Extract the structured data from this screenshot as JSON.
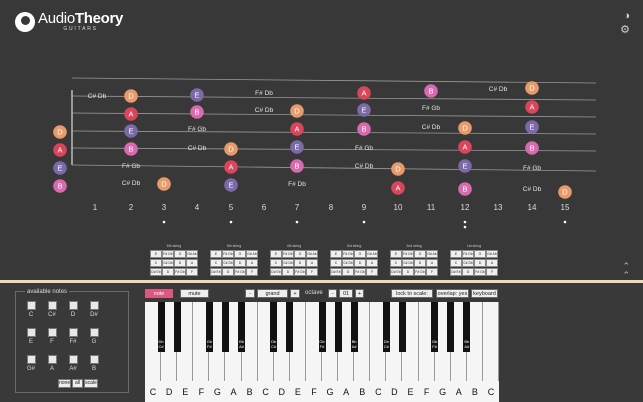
{
  "app": {
    "logo_main_a": "Audio",
    "logo_main_b": "Theory",
    "logo_sub": "GUITARS"
  },
  "toolbar": {
    "help_icon": "help-circle-icon",
    "settings_icon": "gear-icon"
  },
  "fret_numbers": [
    "1",
    "2",
    "3",
    "4",
    "5",
    "6",
    "7",
    "8",
    "9",
    "10",
    "11",
    "12",
    "13",
    "14",
    "15"
  ],
  "inlays": [
    3,
    5,
    7,
    9,
    12,
    15
  ],
  "colors": {
    "E": "#7c6aa8",
    "A": "#d9455a",
    "D": "#e89a6a",
    "B": "#d86ab0",
    "F": "#4b4b4b",
    "accent": "#d95a7e"
  },
  "strings": [
    {
      "name": "6th string",
      "rows": [
        [
          "E",
          "F# Gb",
          "G",
          "G# Ab"
        ],
        [
          "C",
          "C# Db",
          "D",
          "A"
        ],
        [
          "D# Eb",
          "D",
          "F# Gb",
          "F"
        ]
      ]
    },
    {
      "name": "5th string",
      "rows": [
        [
          "E",
          "F# Gb",
          "G",
          "G# Ab"
        ],
        [
          "C",
          "C# Db",
          "D",
          "A"
        ],
        [
          "D# Eb",
          "D",
          "F# Gb",
          "F"
        ]
      ]
    },
    {
      "name": "4th string",
      "rows": [
        [
          "E",
          "F# Gb",
          "G",
          "G# Ab"
        ],
        [
          "C",
          "C# Db",
          "D",
          "A"
        ],
        [
          "D# Eb",
          "D",
          "F# Gb",
          "F"
        ]
      ]
    },
    {
      "name": "3rd string",
      "rows": [
        [
          "E",
          "F# Gb",
          "G",
          "G# Ab"
        ],
        [
          "C",
          "C# Db",
          "D",
          "A"
        ],
        [
          "D# Eb",
          "D",
          "F# Gb",
          "F"
        ]
      ]
    },
    {
      "name": "2nd string",
      "rows": [
        [
          "E",
          "F# Gb",
          "G",
          "G# Ab"
        ],
        [
          "C",
          "C# Db",
          "D",
          "A"
        ],
        [
          "D# Eb",
          "D",
          "F# Gb",
          "F"
        ]
      ]
    },
    {
      "name": "1st string",
      "rows": [
        [
          "E",
          "F# Gb",
          "G",
          "G# Ab"
        ],
        [
          "C",
          "C# Db",
          "D",
          "A"
        ],
        [
          "D# Eb",
          "D",
          "F# Gb",
          "F"
        ]
      ]
    }
  ],
  "available_notes": {
    "title": "available notes",
    "notes": [
      "C",
      "C#",
      "D",
      "D#",
      "E",
      "F",
      "F#",
      "G",
      "G#",
      "A",
      "A#",
      "B"
    ],
    "buttons": [
      "none",
      "all",
      "scale"
    ]
  },
  "controls": {
    "note": "note",
    "mute": "mute",
    "instrument": "grand piano",
    "minus": "-",
    "plus": "+",
    "octave_label": "octave",
    "octave_value": "01",
    "lock_to_scale": "lock to scale: yes",
    "overlap": "overlap: yes",
    "keyboard": "keyboard"
  },
  "keyboard_labels": [
    "C",
    "D",
    "E",
    "F",
    "G",
    "A",
    "B",
    "C",
    "D",
    "E",
    "F",
    "G",
    "A",
    "B",
    "C",
    "D",
    "E",
    "F",
    "G",
    "A",
    "B",
    "C"
  ],
  "black_key_labels": [
    [
      "Db",
      "C#"
    ],
    [
      "Gb",
      "F#"
    ],
    [
      "Bb",
      "A#"
    ],
    [
      "Db",
      "C#"
    ],
    [
      "Gb",
      "F#"
    ],
    [
      "Bb",
      "A#"
    ]
  ]
}
